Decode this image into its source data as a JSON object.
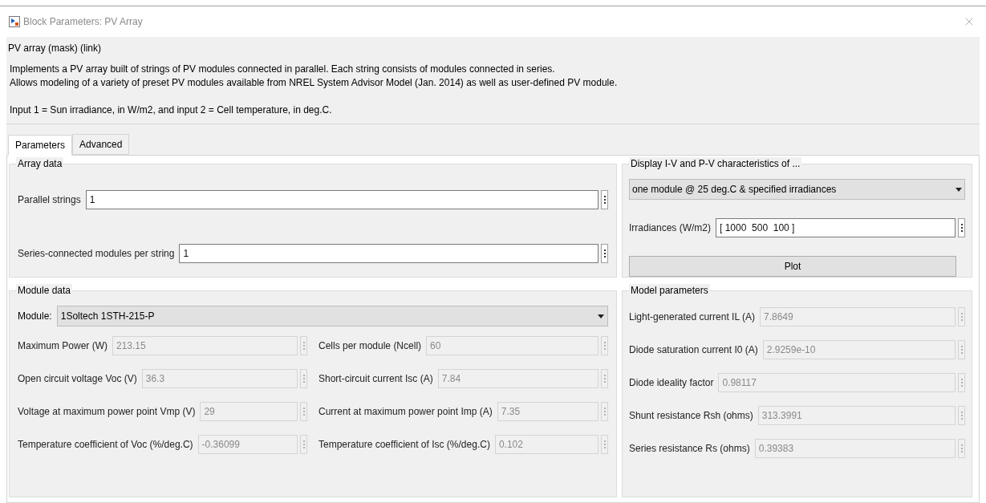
{
  "window": {
    "title": "Block Parameters: PV Array"
  },
  "description": {
    "title": "PV array (mask) (link)",
    "paragraphs": [
      "Implements a PV array built of strings of PV modules connected in parallel. Each string consists of modules connected in series.",
      "Allows modeling of a variety of preset PV modules available from NREL System Advisor Model (Jan. 2014) as well as user-defined PV module.",
      "Input 1 = Sun irradiance, in W/m2, and input 2 = Cell temperature, in deg.C."
    ]
  },
  "tabs": [
    {
      "label": "Parameters",
      "selected": true
    },
    {
      "label": "Advanced",
      "selected": false
    }
  ],
  "array_data": {
    "title": "Array data",
    "fields": [
      {
        "label": "Parallel strings",
        "value": "1",
        "disabled": false
      },
      {
        "label": "Series-connected modules per string",
        "value": "1",
        "disabled": false
      }
    ]
  },
  "display": {
    "title": "Display  I-V and P-V characteristics of ...",
    "dropdown": {
      "value": "one module @ 25 deg.C & specified irradiances"
    },
    "field": {
      "label": "Irradiances (W/m2)",
      "value": "[ 1000  500  100 ]",
      "disabled": false
    },
    "button": "Plot"
  },
  "module_data": {
    "title": "Module data",
    "dropdown": {
      "label": "Module:",
      "value": "1Soltech 1STH-215-P"
    },
    "fields": [
      {
        "label": "Maximum Power (W)",
        "value": "213.15",
        "disabled": true
      },
      {
        "label": "Cells per module (Ncell)",
        "value": "60",
        "disabled": true
      },
      {
        "label": "Open circuit voltage  Voc (V)",
        "value": "36.3",
        "disabled": true
      },
      {
        "label": "Short-circuit current Isc (A)",
        "value": "7.84",
        "disabled": true
      },
      {
        "label": "Voltage at maximum power point Vmp (V)",
        "value": "29",
        "disabled": true
      },
      {
        "label": "Current at maximum power point Imp (A)",
        "value": "7.35",
        "disabled": true
      },
      {
        "label": "Temperature coefficient of Voc (%/deg.C)",
        "value": "-0.36099",
        "disabled": true
      },
      {
        "label": "Temperature coefficient of Isc (%/deg.C)",
        "value": "0.102",
        "disabled": true
      }
    ]
  },
  "model_parameters": {
    "title": "Model parameters",
    "fields": [
      {
        "label": "Light-generated current IL (A)",
        "value": "7.8649",
        "disabled": true
      },
      {
        "label": "Diode saturation current I0 (A)",
        "value": "2.9259e-10",
        "disabled": true
      },
      {
        "label": "Diode ideality factor",
        "value": "0.98117",
        "disabled": true
      },
      {
        "label": "Shunt resistance Rsh (ohms)",
        "value": "313.3991",
        "disabled": true
      },
      {
        "label": "Series resistance Rs (ohms)",
        "value": "0.39383",
        "disabled": true
      }
    ]
  }
}
